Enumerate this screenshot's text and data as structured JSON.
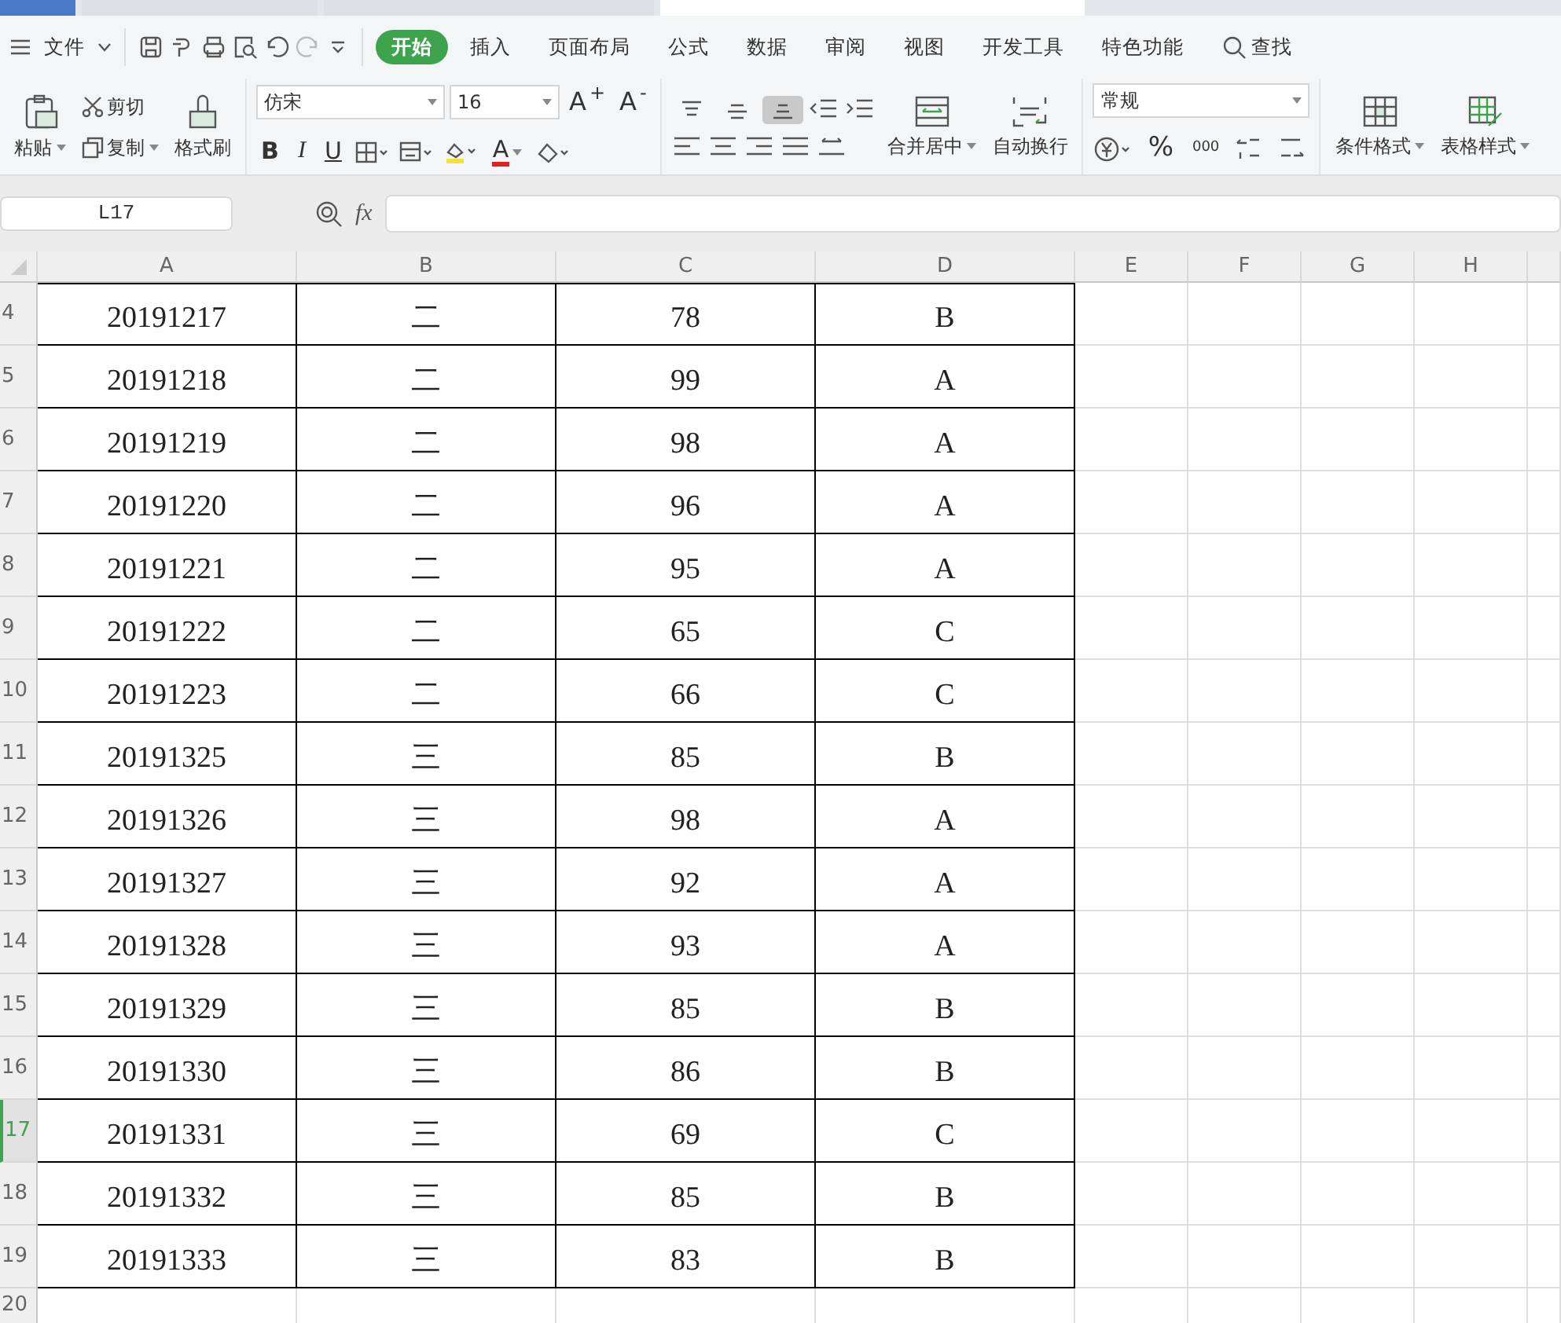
{
  "menu": {
    "file": "文件",
    "tabs": [
      {
        "label": "开始",
        "selected": true
      },
      {
        "label": "插入",
        "selected": false
      },
      {
        "label": "页面布局",
        "selected": false
      },
      {
        "label": "公式",
        "selected": false
      },
      {
        "label": "数据",
        "selected": false
      },
      {
        "label": "审阅",
        "selected": false
      },
      {
        "label": "视图",
        "selected": false
      },
      {
        "label": "开发工具",
        "selected": false
      },
      {
        "label": "特色功能",
        "selected": false
      }
    ],
    "search": "查找"
  },
  "ribbon": {
    "paste": "粘贴",
    "cut": "剪切",
    "copy": "复制",
    "format_painter": "格式刷",
    "font_name": "仿宋",
    "font_size": "16",
    "grow_font": "A$^{+}$",
    "shrink_font": "A$^{-}$",
    "bold": "B",
    "italic": "I",
    "underline": "U",
    "font_color": "A",
    "valign_buttons": [
      {
        "selected": false
      },
      {
        "selected": false
      },
      {
        "selected": true
      }
    ],
    "merge": "合并居中",
    "wrap": "自动换行",
    "number_format": "常规",
    "percent": "%",
    "thousands": "000",
    "conditional_format": "条件格式",
    "table_style": "表格样式"
  },
  "formula_bar": {
    "name_box": "L17",
    "fx": "fx"
  },
  "sheet": {
    "columns": [
      "A",
      "B",
      "C",
      "D",
      "E",
      "F",
      "G",
      "H"
    ],
    "rows": [
      {
        "number": "4",
        "selected": false,
        "cells": [
          "20191217",
          "二",
          "78",
          "B"
        ]
      },
      {
        "number": "5",
        "selected": false,
        "cells": [
          "20191218",
          "二",
          "99",
          "A"
        ]
      },
      {
        "number": "6",
        "selected": false,
        "cells": [
          "20191219",
          "二",
          "98",
          "A"
        ]
      },
      {
        "number": "7",
        "selected": false,
        "cells": [
          "20191220",
          "二",
          "96",
          "A"
        ]
      },
      {
        "number": "8",
        "selected": false,
        "cells": [
          "20191221",
          "二",
          "95",
          "A"
        ]
      },
      {
        "number": "9",
        "selected": false,
        "cells": [
          "20191222",
          "二",
          "65",
          "C"
        ]
      },
      {
        "number": "10",
        "selected": false,
        "cells": [
          "20191223",
          "二",
          "66",
          "C"
        ]
      },
      {
        "number": "11",
        "selected": false,
        "cells": [
          "20191325",
          "三",
          "85",
          "B"
        ]
      },
      {
        "number": "12",
        "selected": false,
        "cells": [
          "20191326",
          "三",
          "98",
          "A"
        ]
      },
      {
        "number": "13",
        "selected": false,
        "cells": [
          "20191327",
          "三",
          "92",
          "A"
        ]
      },
      {
        "number": "14",
        "selected": false,
        "cells": [
          "20191328",
          "三",
          "93",
          "A"
        ]
      },
      {
        "number": "15",
        "selected": false,
        "cells": [
          "20191329",
          "三",
          "85",
          "B"
        ]
      },
      {
        "number": "16",
        "selected": false,
        "cells": [
          "20191330",
          "三",
          "86",
          "B"
        ]
      },
      {
        "number": "17",
        "selected": true,
        "cells": [
          "20191331",
          "三",
          "69",
          "C"
        ]
      },
      {
        "number": "18",
        "selected": false,
        "cells": [
          "20191332",
          "三",
          "85",
          "B"
        ]
      },
      {
        "number": "19",
        "selected": false,
        "cells": [
          "20191333",
          "三",
          "83",
          "B"
        ]
      },
      {
        "number": "20",
        "selected": false,
        "cells": []
      }
    ]
  }
}
